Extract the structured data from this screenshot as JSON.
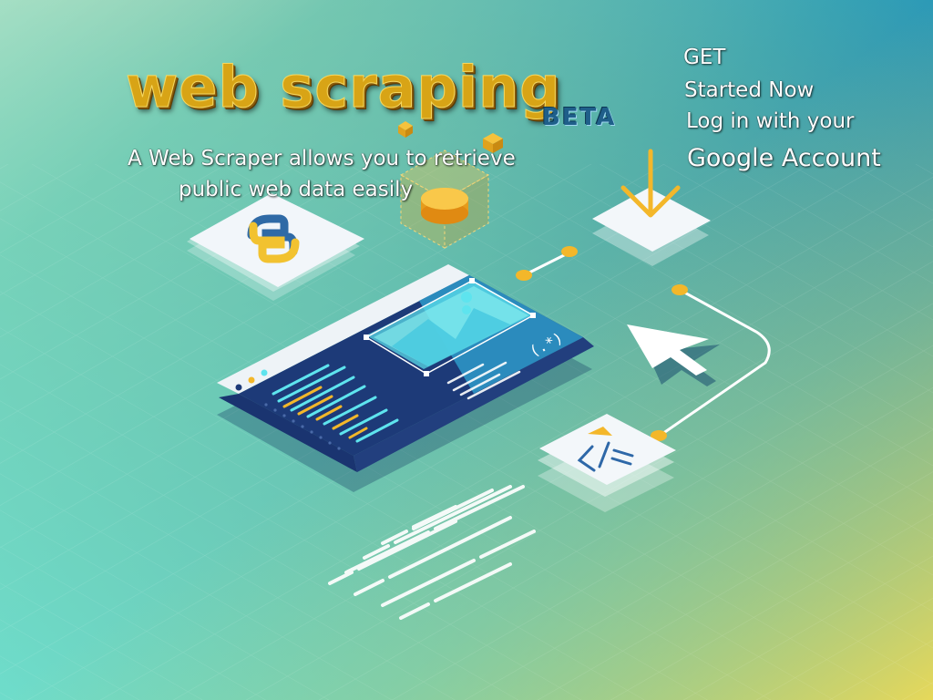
{
  "hero": {
    "logo_text": "web scraping",
    "badge": "BETA",
    "tagline_line1": "A Web Scraper allows you to retrieve",
    "tagline_line2": "public web data easily"
  },
  "cta": {
    "get": "GET",
    "started": "Started Now",
    "login": "Log in with your",
    "account": "Google Account"
  },
  "colors": {
    "accent_gold": "#f3b72a",
    "panel_dark": "#1d3a78",
    "panel_light": "#eef3f7",
    "cyan": "#5ee4ee"
  },
  "icons": {
    "python": "python-logo-icon",
    "download": "download-arrow-icon",
    "cursor": "mouse-cursor-icon",
    "code": "code-tag-icon",
    "regex": "regex-icon"
  }
}
